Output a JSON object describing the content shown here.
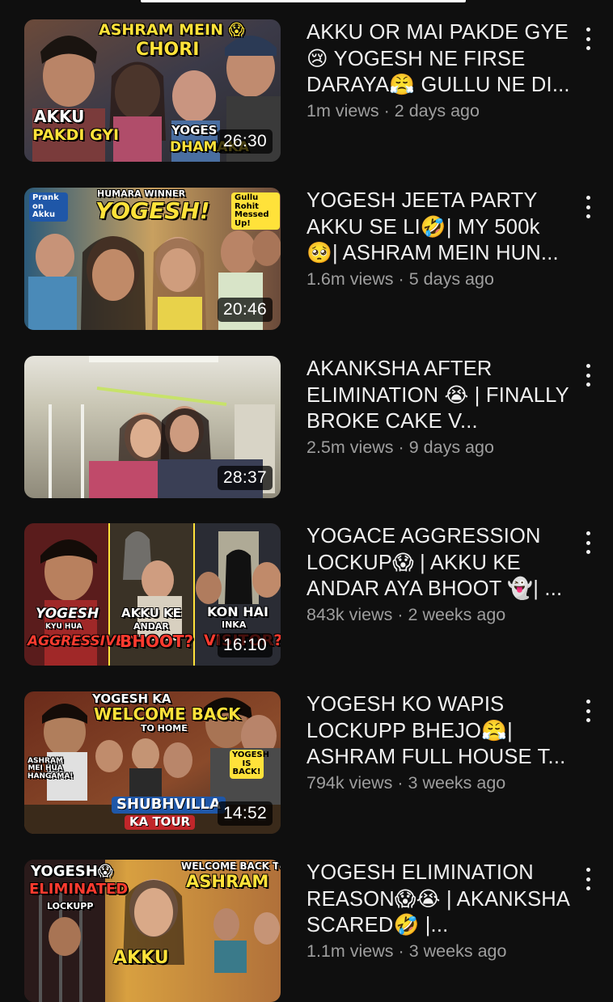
{
  "colors": {
    "background": "#0f0f0f",
    "title_text": "#f1f1f1",
    "meta_text": "#9e9e9e",
    "duration_bg": "#000000"
  },
  "videos": [
    {
      "title": "AKKU OR MAI PAKDE GYE 😢 YOGESH NE FIRSE DARAYA😤 GULLU NE DI...",
      "views": "1m views",
      "age": "2 days ago",
      "duration": "26:30",
      "thumb_texts": [
        "ASHRAM MEIN 😱",
        "CHORI",
        "AKKU",
        "PAKDI GYI",
        "YOGES",
        "DHAMAKA"
      ]
    },
    {
      "title": "YOGESH JEETA PARTY AKKU SE LI🤣| MY 500k 🥺| ASHRAM MEIN HUN...",
      "views": "1.6m views",
      "age": "5 days ago",
      "duration": "20:46",
      "thumb_texts": [
        "Prank on Akku",
        "HUMARA WINNER",
        "YOGESH!",
        "Gullu Rohit Messed Up!"
      ]
    },
    {
      "title": "AKANKSHA AFTER ELIMINATION 😭 | FINALLY BROKE CAKE V...",
      "views": "2.5m views",
      "age": "9 days ago",
      "duration": "28:37",
      "thumb_texts": []
    },
    {
      "title": "YOGACE AGGRESSION LOCKUP😱 | AKKU KE ANDAR AYA BHOOT 👻| ...",
      "views": "843k views",
      "age": "2 weeks ago",
      "duration": "16:10",
      "thumb_texts": [
        "YOGESH",
        "KYU HUA",
        "AGGRESSIVE?!",
        "AKKU KE",
        "ANDAR",
        "BHOOT?",
        "KON HAI",
        "INKA",
        "VISITOR?"
      ]
    },
    {
      "title": "YOGESH KO WAPIS LOCKUPP BHEJO😤| ASHRAM FULL HOUSE T...",
      "views": "794k views",
      "age": "3 weeks ago",
      "duration": "14:52",
      "thumb_texts": [
        "YOGESH KA",
        "WELCOME BACK",
        "TO HOME",
        "ASHRAM MEI HUA HANGAMA!",
        "YOGESH IS BACK!",
        "SHUBHVILLA",
        "KA TOUR"
      ]
    },
    {
      "title": "YOGESH ELIMINATION REASON😱😭 | AKANKSHA SCARED🤣 |...",
      "views": "1.1m views",
      "age": "3 weeks ago",
      "duration": "",
      "thumb_texts": [
        "YOGESH😱",
        "ELIMINATED",
        "LOCKUPP",
        "WELCOME BACK TO",
        "ASHRAM",
        "AKKU"
      ]
    }
  ],
  "separator": "·"
}
